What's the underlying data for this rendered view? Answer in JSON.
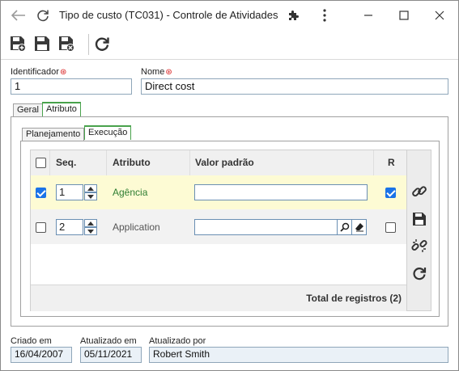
{
  "window": {
    "title": "Tipo de custo (TC031) - Controle de Atividades"
  },
  "form": {
    "identificador_label": "Identificador",
    "identificador_value": "1",
    "nome_label": "Nome",
    "nome_value": "Direct cost"
  },
  "tabs": [
    {
      "label": "Geral"
    },
    {
      "label": "Atributo"
    }
  ],
  "subtabs": [
    {
      "label": "Planejamento"
    },
    {
      "label": "Execução"
    }
  ],
  "grid": {
    "headers": {
      "seq": "Seq.",
      "atributo": "Atributo",
      "valor": "Valor padrão",
      "r": "R"
    },
    "rows": [
      {
        "checked": true,
        "seq": "1",
        "atributo": "Agência",
        "valor": "",
        "r": true
      },
      {
        "checked": false,
        "seq": "2",
        "atributo": "Application",
        "valor": "",
        "r": false
      }
    ],
    "footer": "Total de registros (2)"
  },
  "audit": {
    "criado_label": "Criado em",
    "criado_value": "16/04/2007",
    "atualizado_label": "Atualizado em",
    "atualizado_value": "05/11/2021",
    "atualizado_por_label": "Atualizado por",
    "atualizado_por_value": "Robert Smith"
  },
  "colors": {
    "accent_green": "#49a24c",
    "highlight_row": "#fdfbd4",
    "check_blue": "#1a73e8"
  }
}
